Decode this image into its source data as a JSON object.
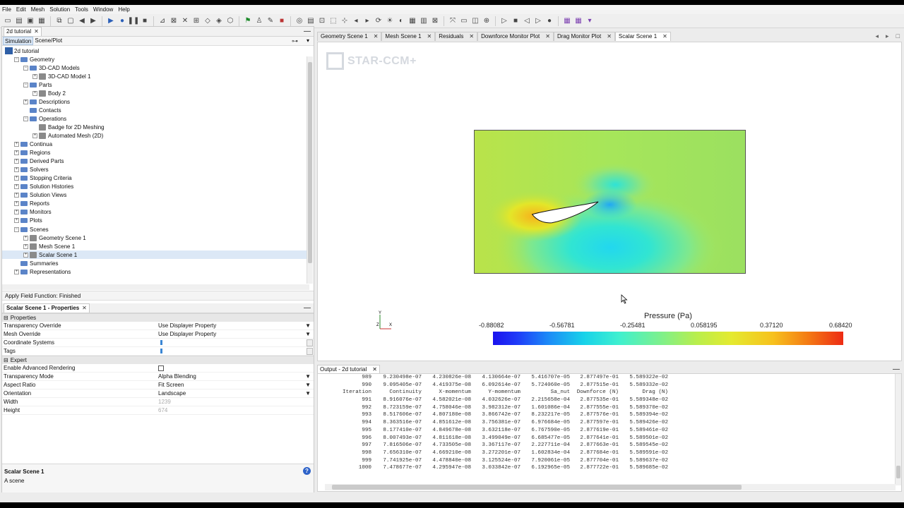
{
  "menu": [
    "File",
    "Edit",
    "Mesh",
    "Solution",
    "Tools",
    "Window",
    "Help"
  ],
  "sim_tab": "2d tutorial",
  "sub_tabs": [
    "Simulation",
    "Scene/Plot"
  ],
  "tree": [
    {
      "label": "2d tutorial",
      "level": 0,
      "kind": "root"
    },
    {
      "label": "Geometry",
      "level": 1,
      "kind": "folder",
      "open": true
    },
    {
      "label": "3D-CAD Models",
      "level": 2,
      "kind": "folder",
      "open": true
    },
    {
      "label": "3D-CAD Model 1",
      "level": 3,
      "kind": "object"
    },
    {
      "label": "Parts",
      "level": 2,
      "kind": "folder",
      "open": true
    },
    {
      "label": "Body 2",
      "level": 3,
      "kind": "object"
    },
    {
      "label": "Descriptions",
      "level": 2,
      "kind": "folder"
    },
    {
      "label": "Contacts",
      "level": 2,
      "kind": "folder",
      "leaf": true
    },
    {
      "label": "Operations",
      "level": 2,
      "kind": "folder",
      "open": true
    },
    {
      "label": "Badge for 2D Meshing",
      "level": 3,
      "kind": "object",
      "leaf": true
    },
    {
      "label": "Automated Mesh (2D)",
      "level": 3,
      "kind": "object"
    },
    {
      "label": "Continua",
      "level": 1,
      "kind": "folder"
    },
    {
      "label": "Regions",
      "level": 1,
      "kind": "folder"
    },
    {
      "label": "Derived Parts",
      "level": 1,
      "kind": "folder"
    },
    {
      "label": "Solvers",
      "level": 1,
      "kind": "folder"
    },
    {
      "label": "Stopping Criteria",
      "level": 1,
      "kind": "folder"
    },
    {
      "label": "Solution Histories",
      "level": 1,
      "kind": "folder"
    },
    {
      "label": "Solution Views",
      "level": 1,
      "kind": "folder"
    },
    {
      "label": "Reports",
      "level": 1,
      "kind": "folder"
    },
    {
      "label": "Monitors",
      "level": 1,
      "kind": "folder"
    },
    {
      "label": "Plots",
      "level": 1,
      "kind": "folder"
    },
    {
      "label": "Scenes",
      "level": 1,
      "kind": "folder",
      "open": true
    },
    {
      "label": "Geometry Scene 1",
      "level": 2,
      "kind": "object"
    },
    {
      "label": "Mesh Scene 1",
      "level": 2,
      "kind": "object"
    },
    {
      "label": "Scalar Scene 1",
      "level": 2,
      "kind": "object",
      "selected": true
    },
    {
      "label": "Summaries",
      "level": 1,
      "kind": "folder",
      "leaf": true
    },
    {
      "label": "Representations",
      "level": 1,
      "kind": "folder"
    }
  ],
  "status": "Apply Field Function: Finished",
  "props_tab": "Scalar Scene 1 - Properties",
  "props": {
    "section_properties": "Properties",
    "section_expert": "Expert",
    "rows1": [
      {
        "key": "Transparency Override",
        "value": "Use Displayer Property",
        "type": "dropdown"
      },
      {
        "key": "Mesh Override",
        "value": "Use Displayer Property",
        "type": "dropdown"
      },
      {
        "key": "Coordinate Systems",
        "value": "",
        "type": "list"
      },
      {
        "key": "Tags",
        "value": "",
        "type": "list"
      }
    ],
    "rows2": [
      {
        "key": "Enable Advanced Rendering",
        "value": "",
        "type": "checkbox"
      },
      {
        "key": "Transparency Mode",
        "value": "Alpha Blending",
        "type": "dropdown"
      },
      {
        "key": "Aspect Ratio",
        "value": "Fit Screen",
        "type": "dropdown"
      },
      {
        "key": "Orientation",
        "value": "Landscape",
        "type": "dropdown"
      },
      {
        "key": "Width",
        "value": "1239",
        "type": "readonly"
      },
      {
        "key": "Height",
        "value": "674",
        "type": "readonly"
      }
    ]
  },
  "help": {
    "title": "Scalar Scene 1",
    "desc": "A scene"
  },
  "view_tabs": [
    "Geometry Scene 1",
    "Mesh Scene 1",
    "Residuals",
    "Downforce Monitor Plot",
    "Drag Monitor Plot",
    "Scalar Scene 1"
  ],
  "active_view_tab": 5,
  "logo_text": "STAR-CCM+",
  "legend": {
    "title": "Pressure (Pa)",
    "ticks": [
      "-0.88082",
      "-0.56781",
      "-0.25481",
      "0.058195",
      "0.37120",
      "0.68420"
    ]
  },
  "axes": {
    "y": "Y",
    "z": "Z",
    "x": "X"
  },
  "output_tab": "Output - 2d tutorial",
  "output": {
    "columns": [
      "Iteration",
      "Continuity",
      "X-momentum",
      "Y-momentum",
      "Sa_nut",
      "Downforce (N)",
      "Drag (N)"
    ],
    "pre_rows": [
      [
        "989",
        "9.230498e-07",
        "4.230826e-08",
        "4.130664e-07",
        "5.416707e-05",
        "2.877497e-01",
        "5.589322e-02"
      ],
      [
        "990",
        "9.095405e-07",
        "4.419375e-08",
        "6.092614e-07",
        "5.724060e-05",
        "2.877515e-01",
        "5.589332e-02"
      ]
    ],
    "rows": [
      [
        "991",
        "8.916076e-07",
        "4.582021e-08",
        "4.032626e-07",
        "2.215658e-04",
        "2.877535e-01",
        "5.589348e-02"
      ],
      [
        "992",
        "8.723159e-07",
        "4.758046e-08",
        "3.982312e-07",
        "1.601086e-04",
        "2.877555e-01",
        "5.589370e-02"
      ],
      [
        "993",
        "8.517606e-07",
        "4.807180e-08",
        "3.866742e-07",
        "8.232217e-05",
        "2.877576e-01",
        "5.589394e-02"
      ],
      [
        "994",
        "8.363516e-07",
        "4.851612e-08",
        "3.756381e-07",
        "6.976684e-05",
        "2.877597e-01",
        "5.589426e-02"
      ],
      [
        "995",
        "8.177410e-07",
        "4.849678e-08",
        "3.632118e-07",
        "6.767590e-05",
        "2.877619e-01",
        "5.589461e-02"
      ],
      [
        "996",
        "8.007493e-07",
        "4.811618e-08",
        "3.499049e-07",
        "6.685477e-05",
        "2.877641e-01",
        "5.589501e-02"
      ],
      [
        "997",
        "7.816506e-07",
        "4.733505e-08",
        "3.367117e-07",
        "2.227711e-04",
        "2.877663e-01",
        "5.589545e-02"
      ],
      [
        "998",
        "7.656310e-07",
        "4.669210e-08",
        "3.272201e-07",
        "1.602834e-04",
        "2.877684e-01",
        "5.589591e-02"
      ],
      [
        "999",
        "7.741925e-07",
        "4.478840e-08",
        "3.125524e-07",
        "7.920061e-05",
        "2.877704e-01",
        "5.589637e-02"
      ],
      [
        "1000",
        "7.478677e-07",
        "4.295947e-08",
        "3.033842e-07",
        "6.192965e-05",
        "2.877722e-01",
        "5.589685e-02"
      ]
    ]
  }
}
